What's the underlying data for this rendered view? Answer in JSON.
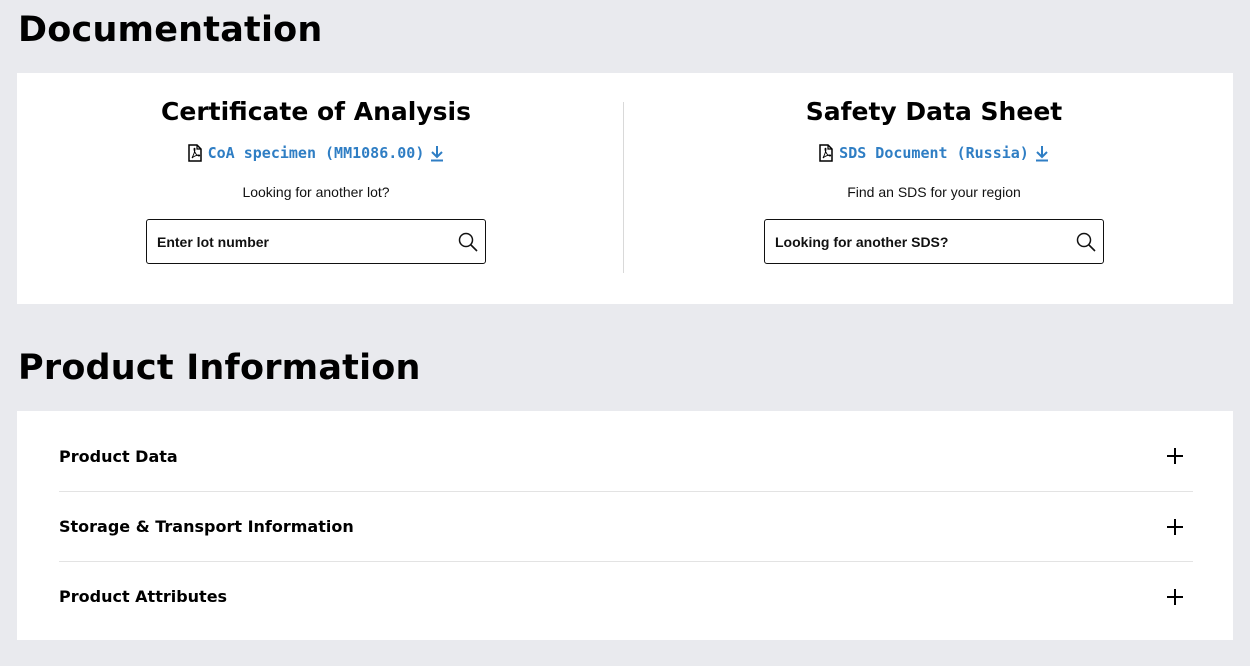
{
  "documentation": {
    "title": "Documentation",
    "coa": {
      "heading": "Certificate of Analysis",
      "link_label": "CoA specimen (MM1086.00)",
      "helper": "Looking for another lot?",
      "search_placeholder": "Enter lot number"
    },
    "sds": {
      "heading": "Safety Data Sheet",
      "link_label": "SDS Document (Russia)",
      "helper": "Find an SDS for your region",
      "search_placeholder": "Looking for another SDS?"
    }
  },
  "product_information": {
    "title": "Product Information",
    "items": [
      {
        "label": "Product Data"
      },
      {
        "label": "Storage & Transport Information"
      },
      {
        "label": "Product Attributes"
      }
    ]
  },
  "colors": {
    "background": "#e9eaee",
    "card": "#ffffff",
    "link": "#2f7ec4"
  },
  "icons": {
    "pdf": "pdf-file-icon",
    "download": "download-icon",
    "search": "search-icon",
    "expand": "plus-icon"
  }
}
